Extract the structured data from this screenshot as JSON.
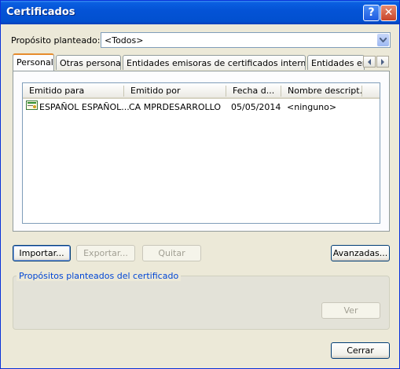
{
  "window": {
    "title": "Certificados"
  },
  "title_buttons": {
    "help": "?",
    "close": "✕"
  },
  "purpose": {
    "label": "Propósito planteado:",
    "value": "<Todos>"
  },
  "tabs": [
    "Personal",
    "Otras personas",
    "Entidades emisoras de certificados intermedias",
    "Entidades emi"
  ],
  "list": {
    "columns": [
      "Emitido para",
      "Emitido por",
      "Fecha d...",
      "Nombre descript..."
    ],
    "rows": [
      {
        "issued_to": "ESPAÑOL ESPAÑOL...",
        "issued_by": "CA MPRDESARROLLO",
        "date": "05/05/2014",
        "friendly_name": "<ninguno>"
      }
    ]
  },
  "buttons": {
    "import": "Importar...",
    "export": "Exportar...",
    "remove": "Quitar",
    "advanced": "Avanzadas...",
    "view": "Ver",
    "close": "Cerrar"
  },
  "group": {
    "title": "Propósitos planteados del certificado"
  }
}
